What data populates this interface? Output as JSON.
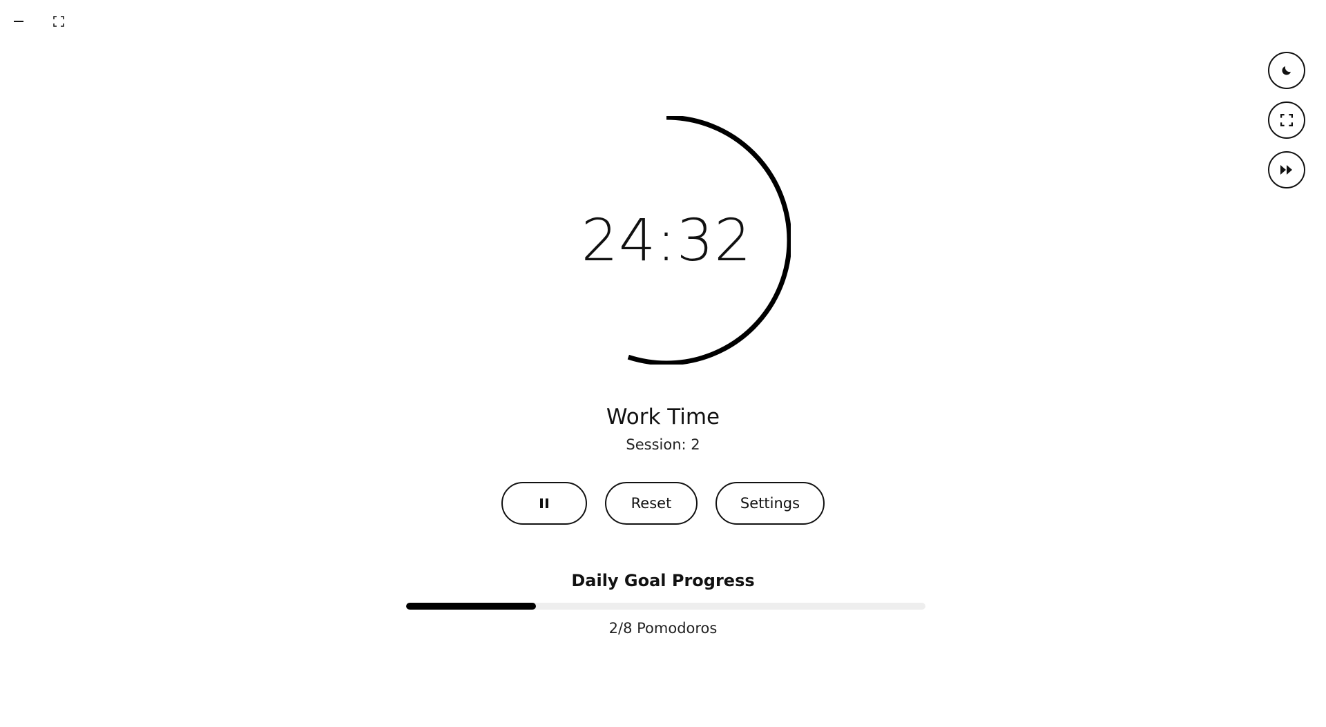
{
  "window_controls": {
    "minimize_icon": "minus-icon",
    "fullscreen_icon": "expand-corners-icon"
  },
  "side_buttons": [
    {
      "icon": "moon-icon",
      "action": "dark-mode"
    },
    {
      "icon": "fullscreen-icon",
      "action": "fullscreen"
    },
    {
      "icon": "fast-forward-icon",
      "action": "skip"
    }
  ],
  "timer": {
    "time": "24:32",
    "ring_progress": 0.55,
    "ring_color": "#000000"
  },
  "mode": {
    "title": "Work Time",
    "session": "Session: 2"
  },
  "controls": {
    "play_pause_icon": "pause-icon",
    "reset_label": "Reset",
    "settings_label": "Settings"
  },
  "daily_goal": {
    "title": "Daily Goal Progress",
    "completed": 2,
    "target": 8,
    "progress_fraction": 0.25,
    "count_label": "2/8 Pomodoros"
  },
  "colors": {
    "accent": "#000000",
    "track": "#eeeeee",
    "background": "#ffffff"
  }
}
